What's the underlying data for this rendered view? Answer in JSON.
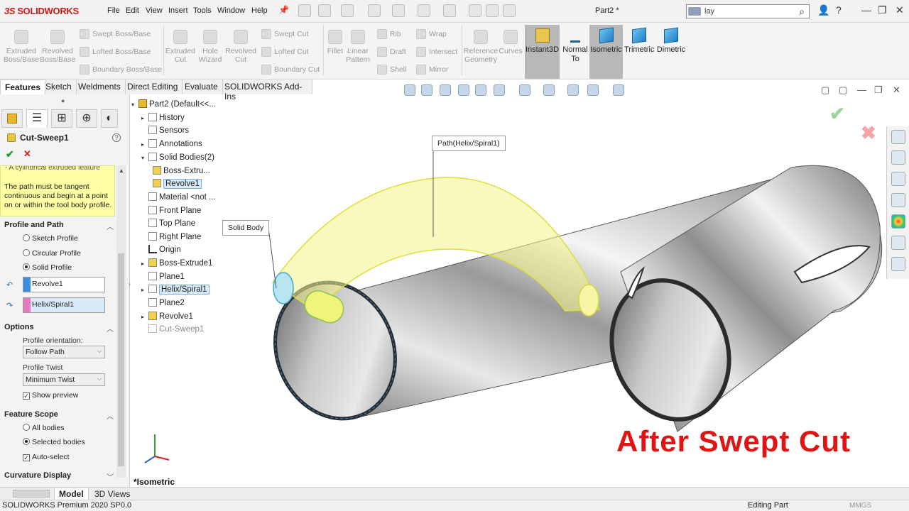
{
  "app": {
    "logo": "SOLIDWORKS",
    "document_title": "Part2 *",
    "menus": [
      "File",
      "Edit",
      "View",
      "Insert",
      "Tools",
      "Window",
      "Help"
    ]
  },
  "search": {
    "value": "lay"
  },
  "command_manager": {
    "features": [
      {
        "label": "Extruded\nBoss/Base",
        "enabled": false
      },
      {
        "label": "Revolved\nBoss/Base",
        "enabled": false
      },
      {
        "label": "Extruded\nCut",
        "enabled": false
      },
      {
        "label": "Hole\nWizard",
        "enabled": false
      },
      {
        "label": "Revolved\nCut",
        "enabled": false
      },
      {
        "label": "Fillet",
        "enabled": false
      },
      {
        "label": "Linear\nPattern",
        "enabled": false
      },
      {
        "label": "Reference\nGeometry",
        "enabled": false
      },
      {
        "label": "Curves",
        "enabled": false
      }
    ],
    "stacked": {
      "boss": [
        "Swept Boss/Base",
        "Lofted Boss/Base",
        "Boundary Boss/Base"
      ],
      "cut": [
        "Swept Cut",
        "Lofted Cut",
        "Boundary Cut"
      ],
      "misc1": [
        "Rib",
        "Draft",
        "Shell"
      ],
      "misc2": [
        "Wrap",
        "Intersect",
        "Mirror"
      ]
    },
    "views": [
      {
        "label": "Instant3D",
        "active": true
      },
      {
        "label": "Normal\nTo",
        "active": false
      },
      {
        "label": "Isometric",
        "active": true
      },
      {
        "label": "Trimetric",
        "active": false
      },
      {
        "label": "Dimetric",
        "active": false
      }
    ]
  },
  "tabs": [
    "Features",
    "Sketch",
    "Weldments",
    "Direct Editing",
    "Evaluate",
    "SOLIDWORKS Add-Ins"
  ],
  "property_manager": {
    "title": "Cut-Sweep1",
    "info_top": "- A cylindrical extruded feature",
    "info_text": "The path must be tangent continuous and begin at a point on or within the tool body profile.",
    "groups": {
      "profile_path": "Profile and Path",
      "options": "Options",
      "feature_scope": "Feature Scope",
      "curvature": "Curvature Display"
    },
    "profile_options": [
      "Sketch Profile",
      "Circular Profile",
      "Solid Profile"
    ],
    "profile_selected": "Solid Profile",
    "profile_field": "Revolve1",
    "path_field": "Helix/Spiral1",
    "orientation_label": "Profile orientation:",
    "orientation_value": "Follow Path",
    "twist_label": "Profile Twist",
    "twist_value": "Minimum Twist",
    "show_preview": "Show preview",
    "scope_options": [
      "All bodies",
      "Selected bodies"
    ],
    "auto_select": "Auto-select"
  },
  "tree": {
    "root": "Part2  (Default<<...",
    "items": [
      "History",
      "Sensors",
      "Annotations",
      "Solid Bodies(2)",
      "Boss-Extru...",
      "Revolve1",
      "Material <not ...",
      "Front Plane",
      "Top Plane",
      "Right Plane",
      "Origin",
      "Boss-Extrude1",
      "Plane1",
      "Helix/Spiral1",
      "Plane2",
      "Revolve1",
      "Cut-Sweep1"
    ]
  },
  "viewport": {
    "callout_path": "Path(Helix/Spiral1)",
    "callout_body": "Solid Body",
    "view_label": "*Isometric",
    "annotation": "After Swept Cut",
    "annotation_color": "#e11414"
  },
  "bottom_tabs": [
    "Model",
    "3D Views"
  ],
  "status": {
    "left": "SOLIDWORKS Premium 2020 SP0.0",
    "mode": "Editing Part",
    "units": "MMGS"
  }
}
